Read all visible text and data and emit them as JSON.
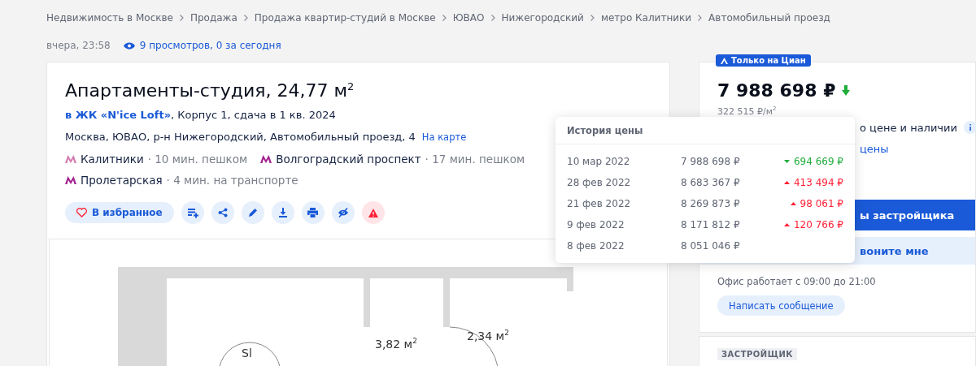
{
  "breadcrumbs": [
    "Недвижимость в Москве",
    "Продажа",
    "Продажа квартир-студий в Москве",
    "ЮВАО",
    "Нижегородский",
    "метро Калитники",
    "Автомобильный проезд"
  ],
  "meta": {
    "date": "вчера, 23:58",
    "views": "9 просмотров, 0 за сегодня"
  },
  "listing": {
    "title": "Апартаменты-студия, 24,77 м$^{2}$",
    "complex_link": "в ЖК «N'ice Loft»",
    "complex_info": ", Корпус 1, сдача в 1 кв. 2024",
    "address": "Москва, ЮВАО, р-н Нижегородский, Автомобильный проезд, 4",
    "map_link": "На карте",
    "metro": [
      {
        "station": "Калитники",
        "time": "· 10 мин. пешком",
        "color": "#d67bb0"
      },
      {
        "station": "Волгоградский проспект",
        "time": "· 17 мин. пешком",
        "color": "#a3228f"
      },
      {
        "station": "Пролетарская",
        "time": "· 4 мин. на транспорте",
        "color": "#a3228f"
      }
    ],
    "favorite_button": "В избранное",
    "actions": [
      {
        "kind": "compare",
        "color": "#1a5ad8"
      },
      {
        "kind": "share",
        "color": "#1a5ad8"
      },
      {
        "kind": "edit",
        "color": "#1a5ad8"
      },
      {
        "kind": "download",
        "color": "#1a5ad8"
      },
      {
        "kind": "print",
        "color": "#1a5ad8"
      },
      {
        "kind": "hide",
        "color": "#1a5ad8"
      },
      {
        "kind": "report",
        "color": "#ff1f34"
      }
    ],
    "plan": {
      "rooms": [
        "3,82 м$^{2}$",
        "2,34 м$^{2}$"
      ],
      "label": "Sl"
    }
  },
  "price_card": {
    "badge": "Только на Циан",
    "price": "7 988 698 ₽",
    "price_per_meter": "322 515 ₽/м$^{2}$",
    "notice_fragment": "о цене и наличии",
    "link_fragment": "цены",
    "primary_button_fragment": "ы застройщика",
    "secondary_button_fragment": "вонитe мне",
    "office_hours": "Офис работает с 09:00 до 21:00",
    "message_button": "Написать сообщение"
  },
  "developer_card": {
    "tag": "ЗАСТРОЙЩИК"
  },
  "price_history": {
    "title": "История цены",
    "rows": [
      {
        "date": "10 мар 2022",
        "price": "7 988 698 ₽",
        "change": "694 669 ₽",
        "price_drop": true
      },
      {
        "date": "28 фев 2022",
        "price": "8 683 367 ₽",
        "change": "413 494 ₽",
        "price_drop": false
      },
      {
        "date": "21 фев 2022",
        "price": "8 269 873 ₽",
        "change": "98 061 ₽",
        "price_drop": false
      },
      {
        "date": "9 фев 2022",
        "price": "8 171 812 ₽",
        "change": "120 766 ₽",
        "price_drop": false
      },
      {
        "date": "8 фев 2022",
        "price": "8 051 046 ₽"
      }
    ]
  }
}
